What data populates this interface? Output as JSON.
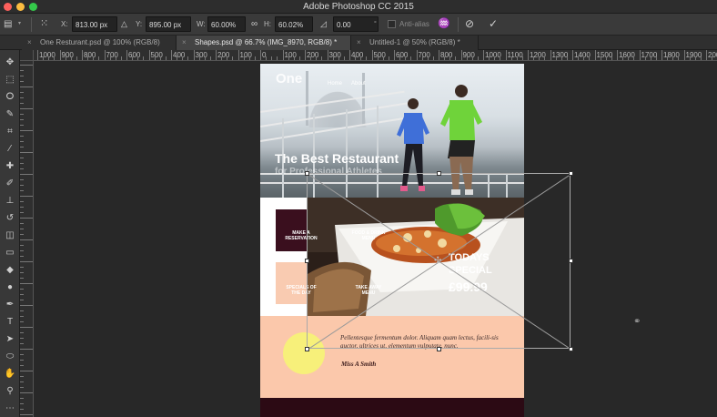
{
  "app": {
    "title": "Adobe Photoshop CC 2015"
  },
  "options_bar": {
    "x_label": "X:",
    "x_value": "813.00 px",
    "y_label": "Y:",
    "y_value": "895.00 px",
    "w_label": "W:",
    "w_value": "60.00%",
    "h_label": "H:",
    "h_value": "60.02%",
    "angle_value": "0.00",
    "degree_symbol": "°",
    "link_glyph": "∞",
    "triangle_glyph": "△",
    "angle_glyph": "◿",
    "antialias_label": "Anti-alias",
    "cancel_glyph": "⊘",
    "commit_glyph": "✓",
    "reference_glyph": "⁙"
  },
  "tabs": [
    {
      "label": "One Resturant.psd @ 100% (RGB/8)",
      "active": false
    },
    {
      "label": "Shapes.psd @ 66.7% (IMG_8970, RGB/8) *",
      "active": true
    },
    {
      "label": "Untitled-1 @ 50% (RGB/8) *",
      "active": false
    }
  ],
  "ruler": {
    "labels": [
      "1000",
      "900",
      "800",
      "700",
      "600",
      "500",
      "400",
      "300",
      "200",
      "100",
      "0",
      "100",
      "200",
      "300",
      "400",
      "500",
      "600",
      "700",
      "800",
      "900",
      "1000",
      "1100",
      "1200",
      "1300",
      "1400",
      "1500",
      "1600",
      "1700",
      "1800",
      "1900",
      "2000"
    ]
  },
  "document": {
    "logo": "One",
    "nav": [
      "Home",
      "About"
    ],
    "hero_title": "The Best Restaurant",
    "hero_subtitle": "for Professional Athletes",
    "tiles": {
      "reservation": "MAKE A\nRESERVATION",
      "food_drink": "FOOD & DRINK\nMENU",
      "specials": "SPECIALS OF\nTHE DAY",
      "takeaway": "TAKE AWAY\nMENU"
    },
    "special_line1": "TODAYS",
    "special_line2": "SPECIAL",
    "special_price": "£99.99",
    "quote": "Pellentesque fermentum dolor. Aliquam quam lectus, facili-sis auctor, ultrices ut, elementum vulputate, nunc.",
    "signature": "Miss A Smith"
  },
  "colors": {
    "accent_dark": "#3a0f1e",
    "peach": "#fbc8ab",
    "yellow": "#f7f07a"
  }
}
